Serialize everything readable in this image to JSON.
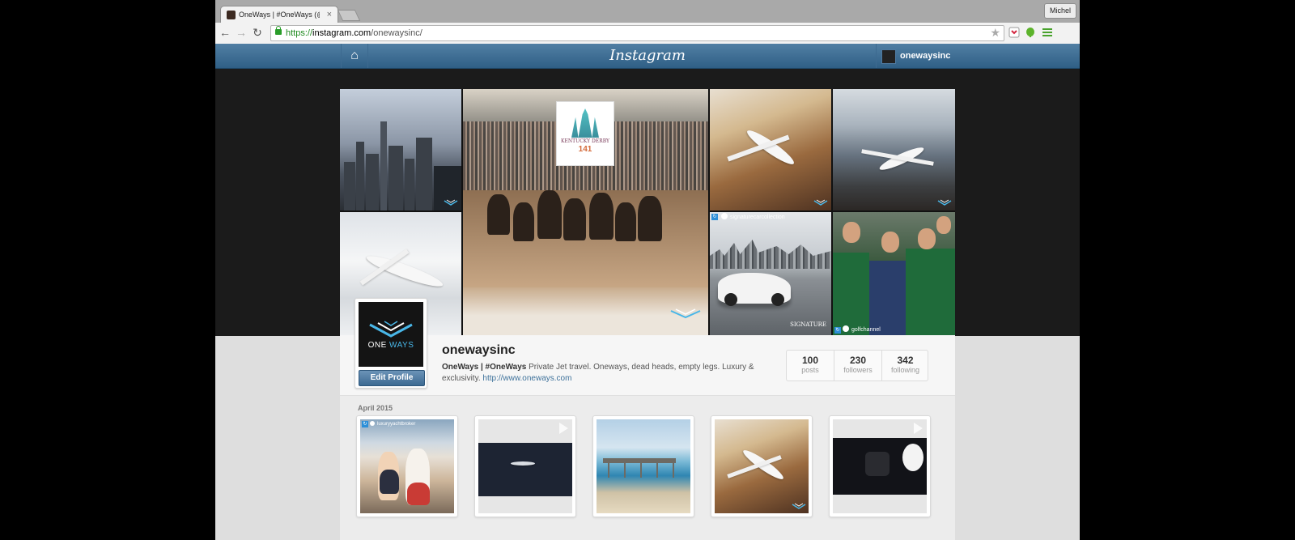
{
  "browser": {
    "tab_title": "OneWays | #OneWays (@on",
    "tab_close": "×",
    "user_name": "Michel",
    "url_scheme": "https://",
    "url_domain": "instagram.com",
    "url_path": "/onewaysinc/",
    "back_icon": "←",
    "forward_icon": "→",
    "reload_icon": "↻",
    "star_icon": "★"
  },
  "instagram": {
    "home_icon": "⌂",
    "logo": "Instagram",
    "account_name": "onewaysinc"
  },
  "collage": {
    "derby_title": "KENTUCKY DERBY",
    "derby_number": "141",
    "tag_signature": "signaturecarcollection",
    "tag_golf": "golfchannel",
    "watermark_text": "ONE WAYS",
    "signature_text": "SIGNATURE"
  },
  "profile": {
    "avatar_word1": "ONE",
    "avatar_word2": "WAYS",
    "edit_button": "Edit Profile",
    "username": "onewaysinc",
    "bio_name": "OneWays | #OneWays",
    "bio_text": " Private Jet travel. Oneways, dead heads, empty legs. Luxury & exclusivity. ",
    "bio_link": "http://www.oneways.com",
    "stats": [
      {
        "num": "100",
        "label": "posts"
      },
      {
        "num": "230",
        "label": "followers"
      },
      {
        "num": "342",
        "label": "following"
      }
    ]
  },
  "feed": {
    "month_label": "April 2015",
    "thumb1_tag": "luxuryyachtbroker"
  },
  "colors": {
    "instagram_blue": "#3f729b",
    "header_top": "#517fa4",
    "header_bottom": "#2f5f86",
    "oneways_accent": "#49b7e8"
  }
}
